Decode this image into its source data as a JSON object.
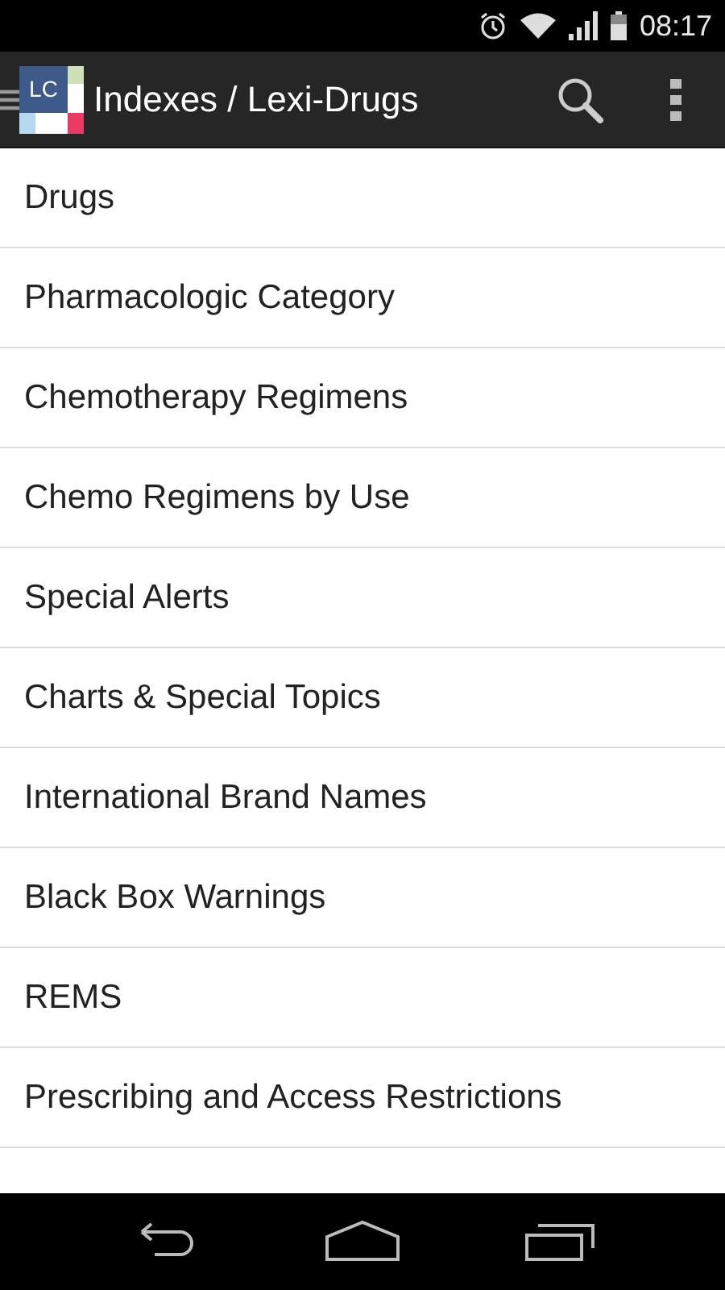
{
  "status_bar": {
    "time": "08:17"
  },
  "action_bar": {
    "logo": "LC",
    "title": "Indexes / Lexi-Drugs"
  },
  "items": [
    {
      "label": "Drugs"
    },
    {
      "label": "Pharmacologic Category"
    },
    {
      "label": "Chemotherapy Regimens"
    },
    {
      "label": "Chemo Regimens by Use"
    },
    {
      "label": "Special Alerts"
    },
    {
      "label": "Charts & Special Topics"
    },
    {
      "label": "International Brand Names"
    },
    {
      "label": "Black Box Warnings"
    },
    {
      "label": "REMS"
    },
    {
      "label": "Prescribing and Access Restrictions"
    }
  ]
}
